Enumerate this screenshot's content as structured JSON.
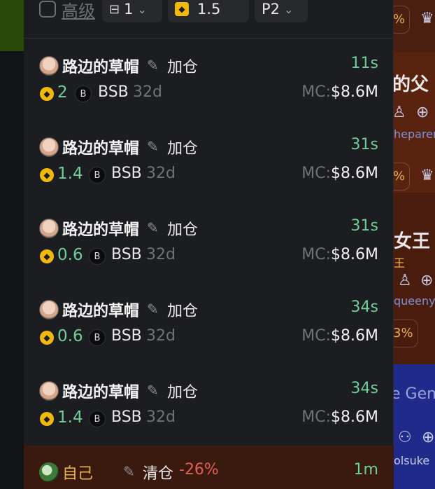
{
  "filter": {
    "advanced_label": "高级",
    "count_value": "1",
    "bnb_value": "1.5",
    "priority_value": "P2"
  },
  "trades": [
    {
      "name": "路边的草帽",
      "action": "加仓",
      "time": "11s",
      "amount": "2",
      "token": "BSB",
      "age": "32d",
      "mc_label": "MC:",
      "mc_value": "$8.6M"
    },
    {
      "name": "路边的草帽",
      "action": "加仓",
      "time": "31s",
      "amount": "1.4",
      "token": "BSB",
      "age": "32d",
      "mc_label": "MC:",
      "mc_value": "$8.6M"
    },
    {
      "name": "路边的草帽",
      "action": "加仓",
      "time": "31s",
      "amount": "0.6",
      "token": "BSB",
      "age": "32d",
      "mc_label": "MC:",
      "mc_value": "$8.6M"
    },
    {
      "name": "路边的草帽",
      "action": "加仓",
      "time": "34s",
      "amount": "0.6",
      "token": "BSB",
      "age": "32d",
      "mc_label": "MC:",
      "mc_value": "$8.6M"
    },
    {
      "name": "路边的草帽",
      "action": "加仓",
      "time": "34s",
      "amount": "1.4",
      "token": "BSB",
      "age": "32d",
      "mc_label": "MC:",
      "mc_value": "$8.6M"
    }
  ],
  "last_trade": {
    "name": "自己",
    "action": "清仓",
    "percent": "-26%",
    "time": "1m"
  },
  "background_right": {
    "text1": "的父",
    "sub1": "heparen",
    "text2": "女王",
    "sub2": "王",
    "sub3": "queeny",
    "text3": "e Gen",
    "sub4": "olsuke",
    "chip1": "%",
    "chip2": "%",
    "chip3": "3%"
  },
  "icons": {
    "token_letter": "B",
    "coin_symbol": "◆"
  },
  "colors": {
    "accent_green": "#6fcf97",
    "negative_red": "#e0605a",
    "bnb_gold": "#f0b90b"
  }
}
